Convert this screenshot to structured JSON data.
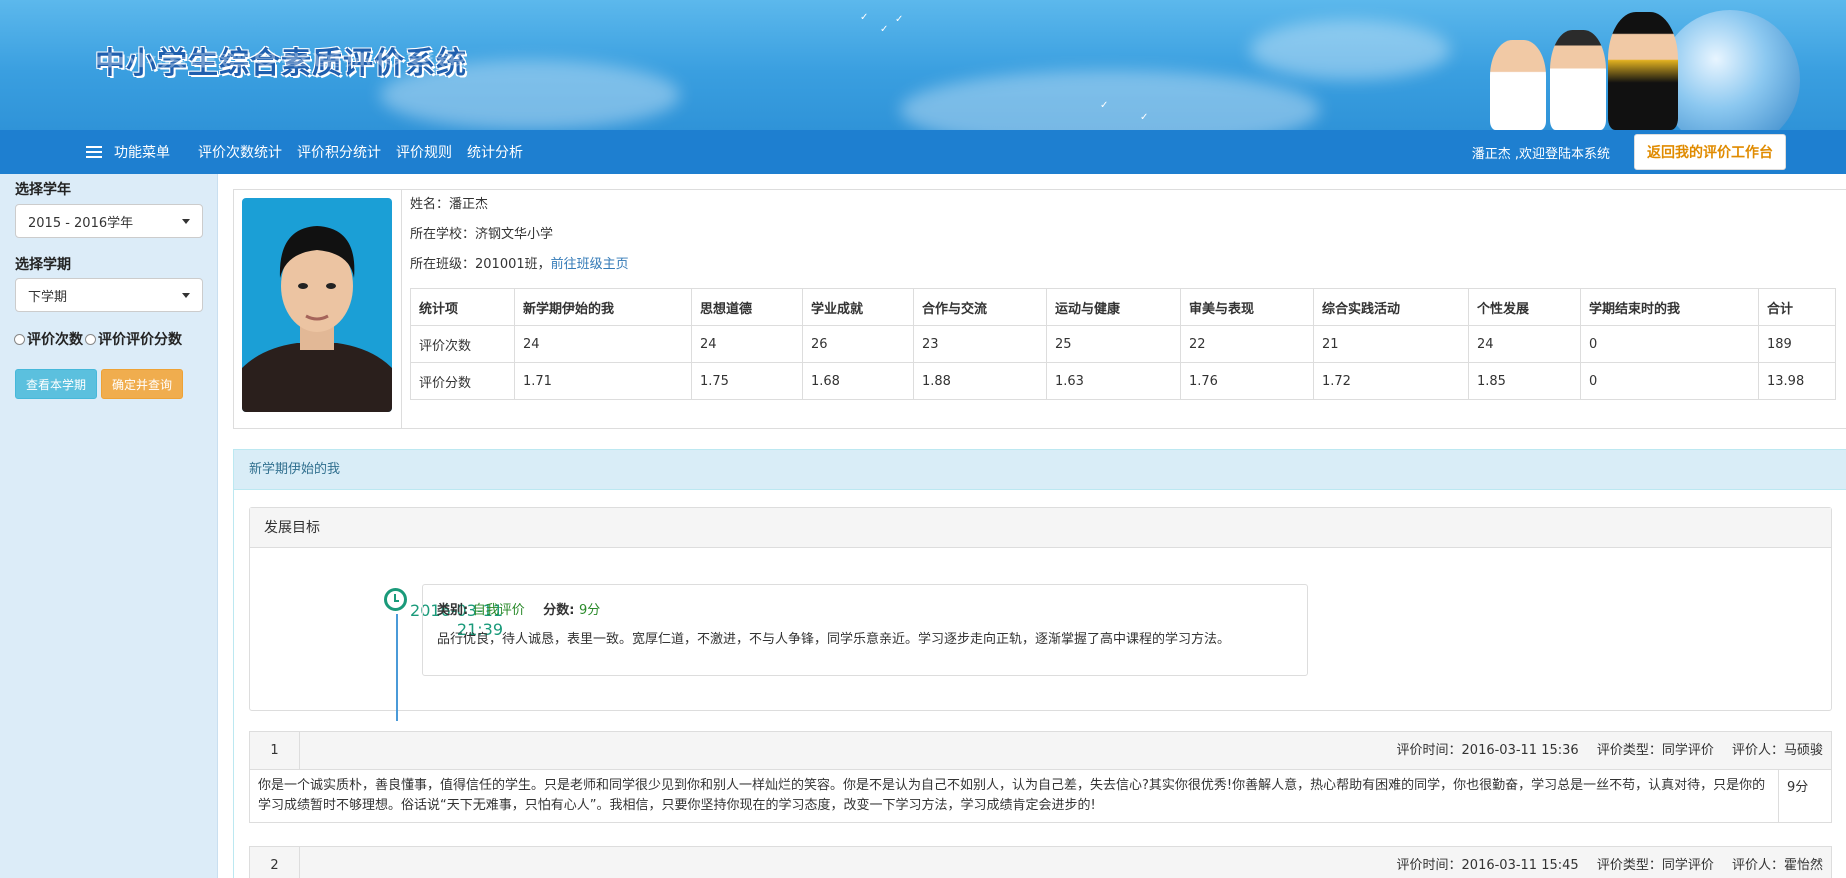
{
  "site_title": "中小学生综合素质评价系统",
  "nav": {
    "menu_label": "功能菜单",
    "links": [
      "评价次数统计",
      "评价积分统计",
      "评价规则",
      "统计分析"
    ],
    "welcome": "潘正杰 ,欢迎登陆本系统",
    "workbench_button": "返回我的评价工作台"
  },
  "sidebar": {
    "year_label": "选择学年",
    "year_value": "2015 - 2016学年",
    "term_label": "选择学期",
    "term_value": "下学期",
    "radio_count": "评价次数",
    "radio_score": "评价评价分数",
    "btn_current": "查看本学期",
    "btn_query": "确定并查询"
  },
  "profile": {
    "name_line": "姓名：潘正杰",
    "school_line": "所在学校：济钢文华小学",
    "class_prefix": "所在班级：201001班，",
    "class_link": "前往班级主页"
  },
  "stats": {
    "headers": [
      "统计项",
      "新学期伊始的我",
      "思想道德",
      "学业成就",
      "合作与交流",
      "运动与健康",
      "审美与表现",
      "综合实践活动",
      "个性发展",
      "学期结束时的我",
      "合计"
    ],
    "rows": [
      [
        "评价次数",
        "24",
        "24",
        "26",
        "23",
        "25",
        "22",
        "21",
        "24",
        "0",
        "189"
      ],
      [
        "评价分数",
        "1.71",
        "1.75",
        "1.68",
        "1.88",
        "1.63",
        "1.76",
        "1.72",
        "1.85",
        "0",
        "13.98"
      ]
    ]
  },
  "section": {
    "title": "新学期伊始的我",
    "goal_title": "发展目标",
    "timeline": {
      "date": "2016-03-11",
      "time": "21:39",
      "category_label": "类别:",
      "category_value": "自我评价",
      "score_label": "分数:",
      "score_value": "9分",
      "text": "品行优良，待人诚恳，表里一致。宽厚仁道，不激进，不与人争锋，同学乐意亲近。学习逐步走向正轨，逐渐掌握了高中课程的学习方法。"
    },
    "evaluations": [
      {
        "num": "1",
        "time": "评价时间：2016-03-11 15:36",
        "type": "评价类型：同学评价",
        "evaluator": "评价人：马硕骏",
        "text": "你是一个诚实质朴，善良懂事，值得信任的学生。只是老师和同学很少见到你和别人一样灿烂的笑容。你是不是认为自己不如别人，认为自己差，失去信心?其实你很优秀!你善解人意，热心帮助有困难的同学，你也很勤奋，学习总是一丝不苟，认真对待，只是你的学习成绩暂时不够理想。俗话说“天下无难事，只怕有心人”。我相信，只要你坚持你现在的学习态度，改变一下学习方法，学习成绩肯定会进步的!",
        "score": "9分"
      },
      {
        "num": "2",
        "time": "评价时间：2016-03-11 15:45",
        "type": "评价类型：同学评价",
        "evaluator": "评价人：霍怡然"
      }
    ]
  }
}
